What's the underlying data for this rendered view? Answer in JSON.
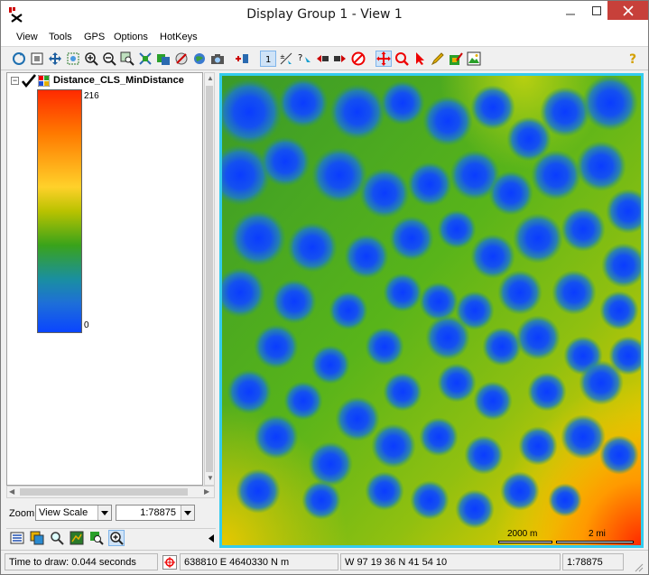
{
  "window": {
    "title": "Display Group 1 - View 1"
  },
  "menu": [
    {
      "label": "View"
    },
    {
      "label": "Tools"
    },
    {
      "label": "GPS"
    },
    {
      "label": "Options"
    },
    {
      "label": "HotKeys"
    }
  ],
  "legend": {
    "layer_name": "Distance_CLS_MinDistance",
    "max_value": "216",
    "min_value": "0"
  },
  "zoom": {
    "label": "Zoom",
    "mode": "View Scale",
    "scale": "1:78875"
  },
  "map": {
    "scale_metric": "2000 m",
    "scale_imperial": "2 mi"
  },
  "status": {
    "time_to_draw": "Time to draw: 0.044 seconds",
    "coords_utm": "638810 E  4640330 N m",
    "coords_geo": "W 97 19 36  N 41 54 10",
    "scale": "1:78875"
  },
  "colors": {
    "map_border": "#33ccee",
    "close_button": "#c7403a",
    "near": "#0a45ff",
    "mid": "#3aa31a",
    "far": "#ff2a00"
  }
}
